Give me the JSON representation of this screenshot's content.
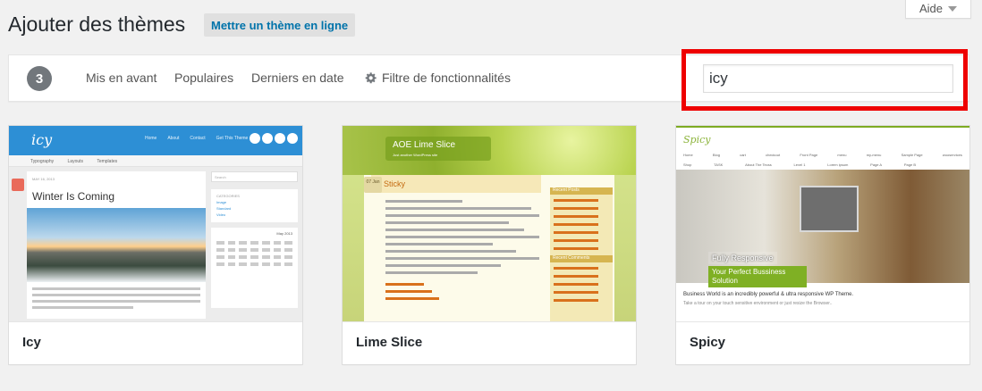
{
  "help": {
    "label": "Aide"
  },
  "header": {
    "title": "Ajouter des thèmes",
    "upload_label": "Mettre un thème en ligne"
  },
  "filter": {
    "count": "3",
    "links": [
      "Mis en avant",
      "Populaires",
      "Derniers en date"
    ],
    "feature_filter_label": "Filtre de fonctionnalités"
  },
  "search": {
    "value": "icy"
  },
  "themes": [
    {
      "name": "Icy",
      "preview": {
        "logo": "icy",
        "nav": [
          "Home",
          "About",
          "Contact",
          "Get This Theme"
        ],
        "subnav": "Typography Layouts Templates",
        "post_meta": "MAY 16, 2013",
        "post_title": "Winter Is Coming",
        "search_placeholder": "Search",
        "categories_title": "CATEGORIES",
        "categories": "Image\nStandard\nVideo",
        "calendar_title": "May 2013"
      }
    },
    {
      "name": "Lime Slice",
      "preview": {
        "site_title": "AOE Lime Slice",
        "tagline": "Just another WordPress site",
        "date": "07 Jan",
        "post_title": "Sticky",
        "recent_posts": "Recent Posts",
        "recent_comments": "Recent Comments"
      }
    },
    {
      "name": "Spicy",
      "preview": {
        "logo": "Spicy",
        "nav": [
          "Home",
          "Blog",
          "cart",
          "checkout",
          "Front Page",
          "menu",
          "my-menu",
          "Sample Page",
          "wooservices"
        ],
        "nav2": [
          "Shop",
          "TASK",
          "About The Tecss",
          "Level 1",
          "Lorem ipsum",
          "Page A",
          "Page B"
        ],
        "hero_line1": "Fully Responsive",
        "hero_line2": "Your Perfect Bussiness Solution",
        "caption1": "Business World is an incredibly powerful & ultra responsive WP Theme.",
        "caption2": "Take a tour on your touch sensitive environment or just resize the Browser.."
      }
    }
  ],
  "colors": {
    "accent": "#0073aa",
    "highlight": "#ee0000",
    "count_badge": "#72777c"
  }
}
